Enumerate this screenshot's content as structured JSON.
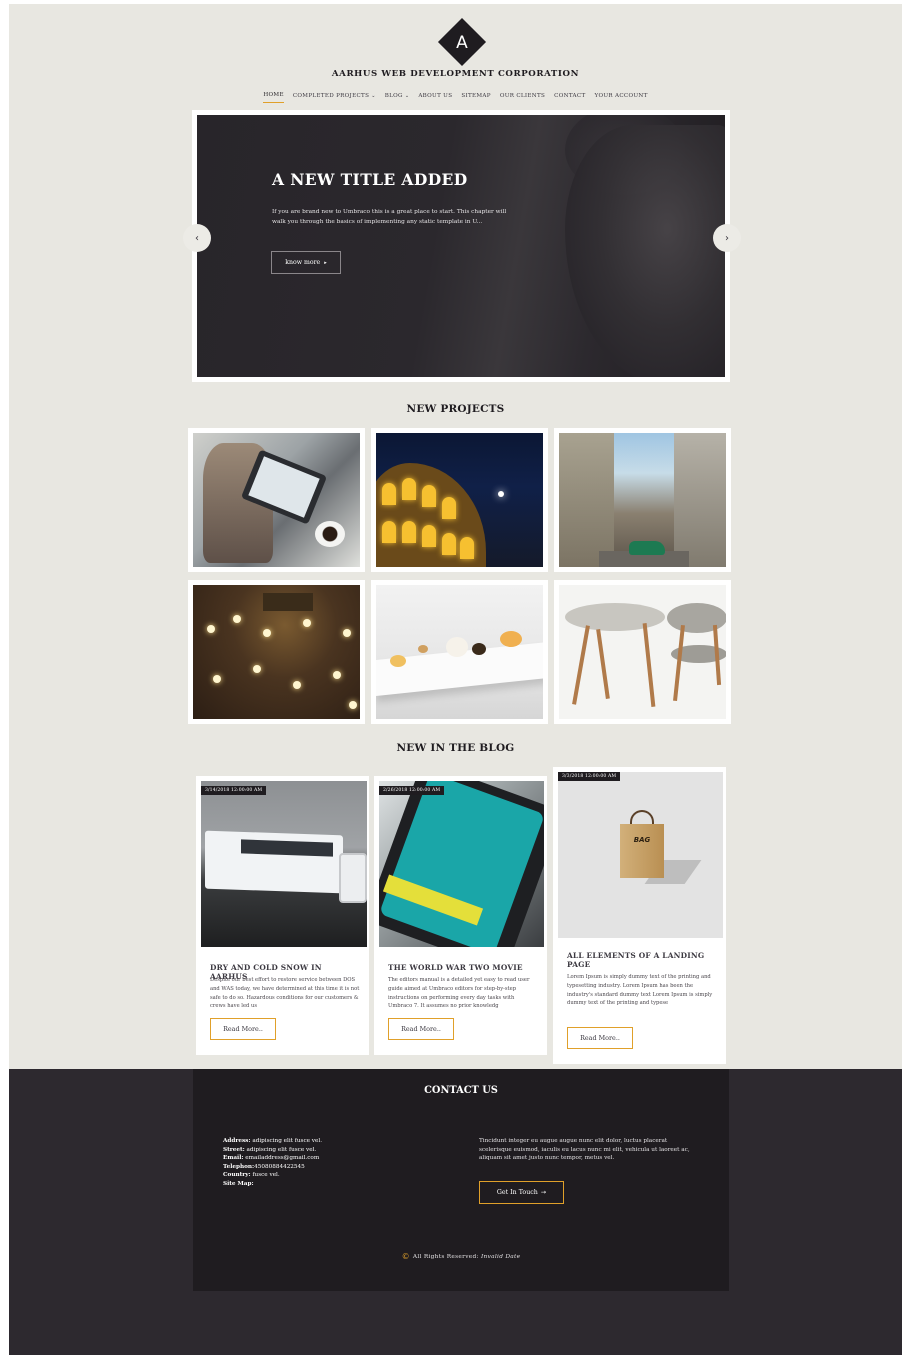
{
  "header": {
    "logo_letter": "A",
    "site_title": "AARHUS WEB DEVELOPMENT CORPORATION"
  },
  "nav": {
    "items": [
      {
        "label": "HOME",
        "active": true,
        "has_dropdown": false
      },
      {
        "label": "COMPLETED PROJECTS",
        "active": false,
        "has_dropdown": true
      },
      {
        "label": "BLOG",
        "active": false,
        "has_dropdown": true
      },
      {
        "label": "ABOUT US",
        "active": false,
        "has_dropdown": false
      },
      {
        "label": "SITEMAP",
        "active": false,
        "has_dropdown": false
      },
      {
        "label": "OUR CLIENTS",
        "active": false,
        "has_dropdown": false
      },
      {
        "label": "CONTACT",
        "active": false,
        "has_dropdown": false
      },
      {
        "label": "YOUR ACCOUNT",
        "active": false,
        "has_dropdown": false
      }
    ],
    "dropdown_icon": "chevron-down-icon"
  },
  "slider": {
    "title": "A NEW TITLE ADDED",
    "text": "If you are brand new to Umbraco this is a great place to start. This chapter will walk you through the basics of implementing any static template in U...",
    "button_label": "know more",
    "button_icon": "caret-right-icon",
    "prev_icon": "chevron-left-icon",
    "next_icon": "chevron-right-icon"
  },
  "projects": {
    "heading": "NEW PROJECTS",
    "tiles": [
      "tablet-coffee",
      "colosseum-night",
      "havana-street",
      "concert-hall",
      "plated-dish",
      "side-tables"
    ]
  },
  "blog": {
    "heading": "NEW IN THE BLOG",
    "posts": [
      {
        "date": "3/14/2018 12:00:00 AM",
        "title": "DRY AND COLD SNOW IN AARHUS",
        "excerpt": "Despite our best effort to restore service between DOS and WAS today, we have determined at this time it is not safe to do so. Hazardous conditions for our customers & crews have led us",
        "button_label": "Read More.."
      },
      {
        "date": "2/26/2018 12:00:00 AM",
        "title": "THE WORLD WAR TWO MOVIE",
        "excerpt": "The editors manual is a detailed yet easy to read user guide aimed at Umbraco editors for step-by-step instructions on performing every day tasks with Umbraco 7. It assumes no prior knowledg",
        "button_label": "Read More.."
      },
      {
        "date": "3/3/2018 12:00:00 AM",
        "title": "ALL ELEMENTS OF A LANDING PAGE",
        "excerpt": "Lorem Ipsum is simply dummy text of the printing and typesetting industry. Lorem Ipsum has been the industry's standard dummy text Lorem Ipsum is simply dummy text of the printing and typese",
        "button_label": "Read More..",
        "image_label": "BAG"
      }
    ]
  },
  "footer": {
    "title": "CONTACT US",
    "address_label": "Address:",
    "address_value": "adipiscing elit fusce vel.",
    "street_label": "Street:",
    "street_value": "adipiscing elit fusce vel.",
    "email_label": "Email:",
    "email_value": "emailaddress@gmail.com",
    "telephone_label": "Telephon:",
    "telephone_value": "45080884422545",
    "country_label": "Country:",
    "country_value": "fusce vel.",
    "sitemap_label": "Site Map:",
    "text": "Tincidunt integer eu augue augue nunc elit dolor, luctus placerat scelerisque euismod, iaculis eu lacus nunc mi elit, vehicula ut laoreet ac, aliquam sit amet justo nunc tempor, metus vel.",
    "button_label": "Get In Touch",
    "button_icon": "arrow-right-icon",
    "copyright_symbol": "©",
    "copyright_text": "All Rights Reserved:",
    "copyright_date": "Invalid Date"
  },
  "colors": {
    "background": "#e8e7e1",
    "dark": "#1f1c20",
    "accent": "#e0a02a"
  }
}
